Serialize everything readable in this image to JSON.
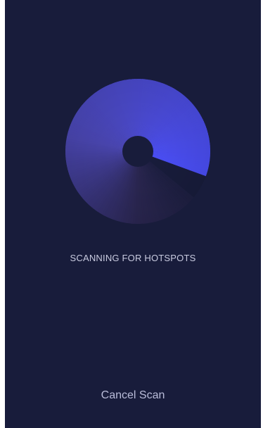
{
  "scan": {
    "status_text": "SCANNING FOR HOTSPOTS",
    "cancel_label": "Cancel Scan"
  },
  "radar": {
    "icon": "radar-sweep-icon"
  },
  "colors": {
    "background": "#181c3b",
    "sweep_bright": "#4a4ef5",
    "sweep_mid": "#4a46b0",
    "sweep_dim": "#2a2650",
    "text": "#c9cbe0"
  }
}
